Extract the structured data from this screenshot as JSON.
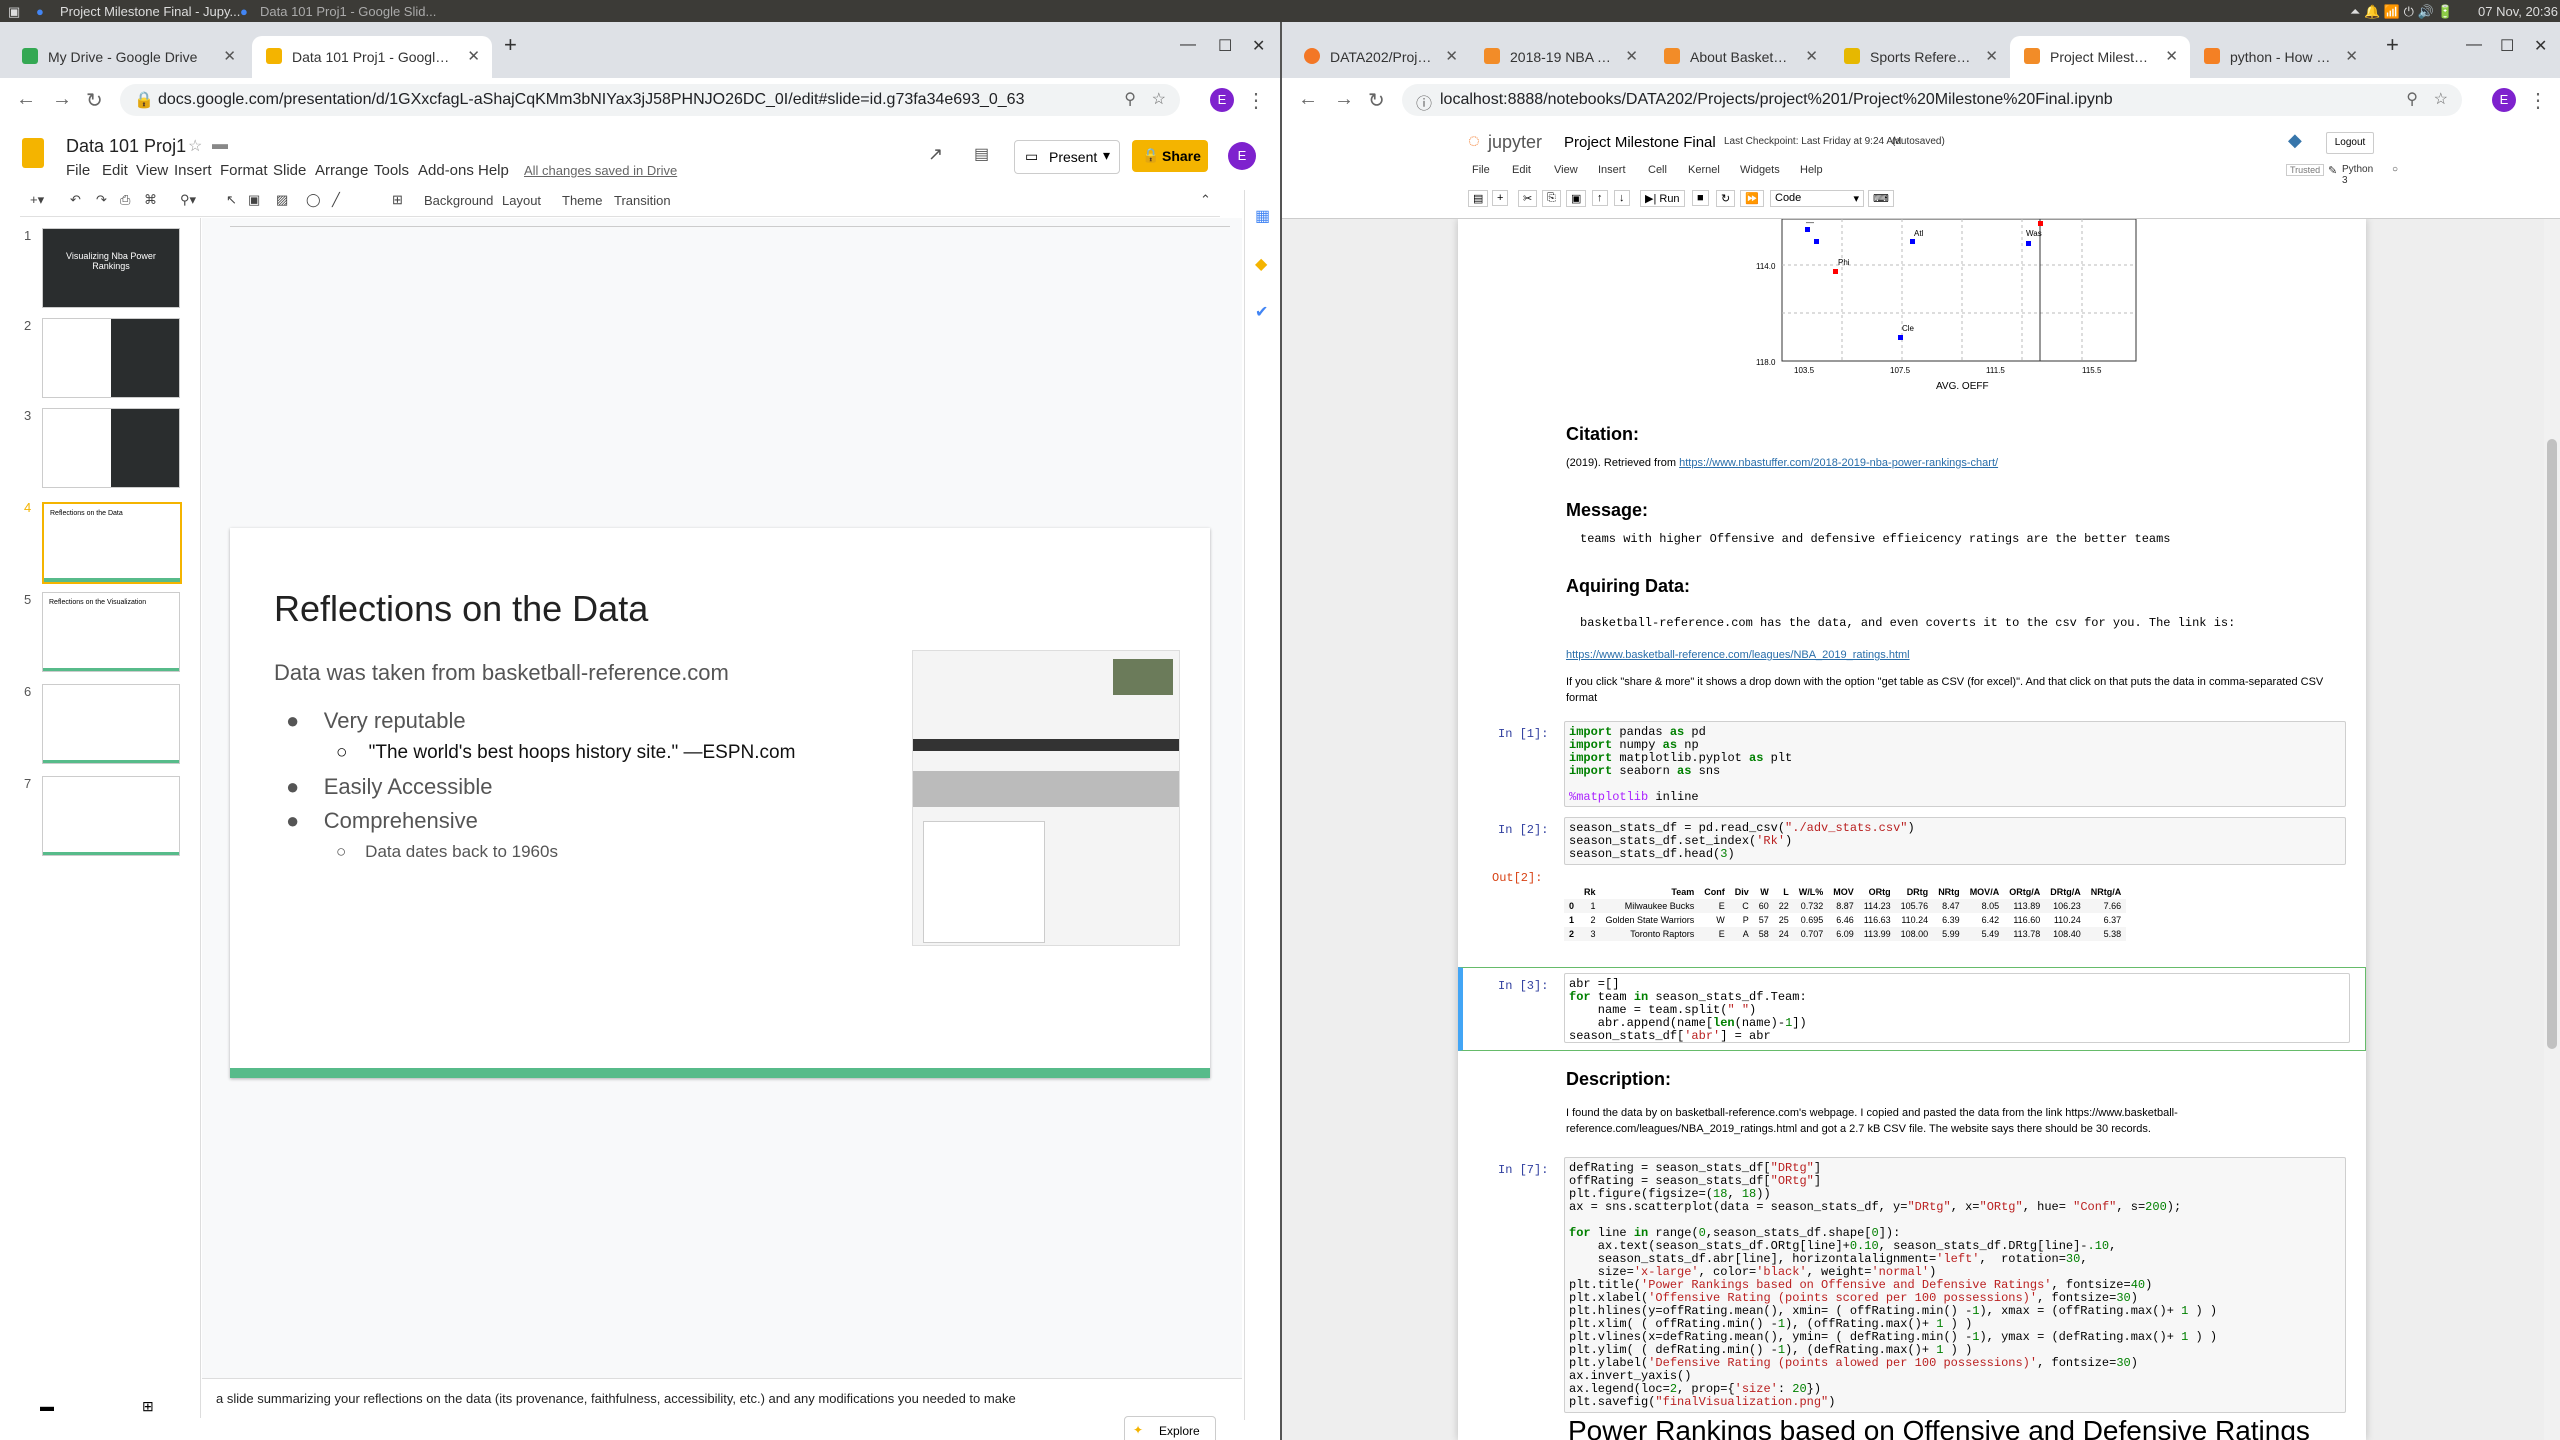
{
  "os": {
    "window_title": "Project Milestone Final - Jupy...",
    "second_title": "Data 101 Proj1 - Google Slid...",
    "clock": "07 Nov, 20:36"
  },
  "left": {
    "tabs": [
      {
        "label": "My Drive - Google Drive"
      },
      {
        "label": "Data 101 Proj1 - Google Slides"
      }
    ],
    "url": "docs.google.com/presentation/d/1GXxcfagL-aShajCqKMm3bNIYax3jJ58PHNJO26DC_0I/edit#slide=id.g73fa34e693_0_63",
    "doc_title": "Data 101 Proj1",
    "menu": [
      "File",
      "Edit",
      "View",
      "Insert",
      "Format",
      "Slide",
      "Arrange",
      "Tools",
      "Add-ons",
      "Help"
    ],
    "save_status": "All changes saved in Drive",
    "present_label": "Present",
    "share_label": "Share",
    "toolbar_text": {
      "background": "Background",
      "layout": "Layout",
      "theme": "Theme",
      "transition": "Transition",
      "zoom": "▾"
    },
    "thumbs": [
      {
        "num": "1",
        "title": "Visualizing Nba Power Rankings"
      },
      {
        "num": "2",
        "title": ""
      },
      {
        "num": "3",
        "title": ""
      },
      {
        "num": "4",
        "title": "Reflections on the Data"
      },
      {
        "num": "5",
        "title": "Reflections on the Visualization"
      },
      {
        "num": "6",
        "title": ""
      },
      {
        "num": "7",
        "title": ""
      }
    ],
    "slide": {
      "title": "Reflections on the Data",
      "subtitle": "Data was taken from basketball-reference.com",
      "b1": "Very reputable",
      "b1a": "\"The world's best hoops history site.\" —ESPN.com",
      "b2": "Easily Accessible",
      "b3": "Comprehensive",
      "b3a": "Data dates back to 1960s"
    },
    "notes": "a slide summarizing your reflections on the data (its provenance, faithfulness, accessibility, etc.) and any modifications you needed to make",
    "explore": "Explore"
  },
  "right": {
    "tabs": [
      {
        "label": "DATA202/Projects/p"
      },
      {
        "label": "2018-19 NBA Team R"
      },
      {
        "label": "About Basketball-Re"
      },
      {
        "label": "Sports Reference | S"
      },
      {
        "label": "Project Milestone Fin"
      },
      {
        "label": "python - How to cha"
      }
    ],
    "url": "localhost:8888/notebooks/DATA202/Projects/project%201/Project%20Milestone%20Final.ipynb",
    "jupyter": "jupyter",
    "nb_title": "Project Milestone Final",
    "checkpoint": "Last Checkpoint: Last Friday at 9:24 AM",
    "autosaved": "(autosaved)",
    "logout": "Logout",
    "menu": [
      "File",
      "Edit",
      "View",
      "Insert",
      "Cell",
      "Kernel",
      "Widgets",
      "Help"
    ],
    "trusted": "Trusted",
    "kernel": "Python 3",
    "run": "Run",
    "celltype": "Code",
    "plot": {
      "xticks": [
        "103.5",
        "107.5",
        "111.5",
        "115.5"
      ],
      "yticks": [
        "114.0",
        "118.0"
      ],
      "xlabel": "AVG. OEFF",
      "labels": [
        "Phi",
        "Atl",
        "Was",
        "Cle"
      ]
    },
    "citation_h": "Citation:",
    "citation": "(2019). Retrieved from ",
    "citation_link": "https://www.nbastuffer.com/2018-2019-nba-power-rankings-chart/",
    "message_h": "Message:",
    "message": "teams with higher Offensive and defensive effieicency ratings are the better teams",
    "acq_h": "Aquiring Data:",
    "acq1": "basketball-reference.com has the data, and even coverts it to the csv for you. The link is:",
    "acq_link": "https://www.basketball-reference.com/leagues/NBA_2019_ratings.html",
    "acq2": "If you click \"share & more\" it shows a drop down with the option \"get table as CSV (for excel)\". And that click on that puts the data in comma-separated CSV format",
    "in1": "In [1]:",
    "in2": "In [2]:",
    "out2": "Out[2]:",
    "in3": "In [3]:",
    "in7": "In [7]:",
    "table": {
      "headers": [
        "",
        "Rk",
        "Team",
        "Conf",
        "Div",
        "W",
        "L",
        "W/L%",
        "MOV",
        "ORtg",
        "DRtg",
        "NRtg",
        "MOV/A",
        "ORtg/A",
        "DRtg/A",
        "NRtg/A"
      ],
      "rows": [
        [
          "0",
          "1",
          "Milwaukee Bucks",
          "E",
          "C",
          "60",
          "22",
          "0.732",
          "8.87",
          "114.23",
          "105.76",
          "8.47",
          "8.05",
          "113.89",
          "106.23",
          "7.66"
        ],
        [
          "1",
          "2",
          "Golden State Warriors",
          "W",
          "P",
          "57",
          "25",
          "0.695",
          "6.46",
          "116.63",
          "110.24",
          "6.39",
          "6.42",
          "116.60",
          "110.24",
          "6.37"
        ],
        [
          "2",
          "3",
          "Toronto Raptors",
          "E",
          "A",
          "58",
          "24",
          "0.707",
          "6.09",
          "113.99",
          "108.00",
          "5.99",
          "5.49",
          "113.78",
          "108.40",
          "5.38"
        ]
      ]
    },
    "desc_h": "Description:",
    "desc": "I found the data by on basketball-reference.com's webpage. I copied and pasted the data from the link https://www.basketball-reference.com/leagues/NBA_2019_ratings.html and got a 2.7 kB CSV file. The website says there should be 30 records.",
    "big_title": "Power Rankings based on Offensive and Defensive Ratings"
  }
}
